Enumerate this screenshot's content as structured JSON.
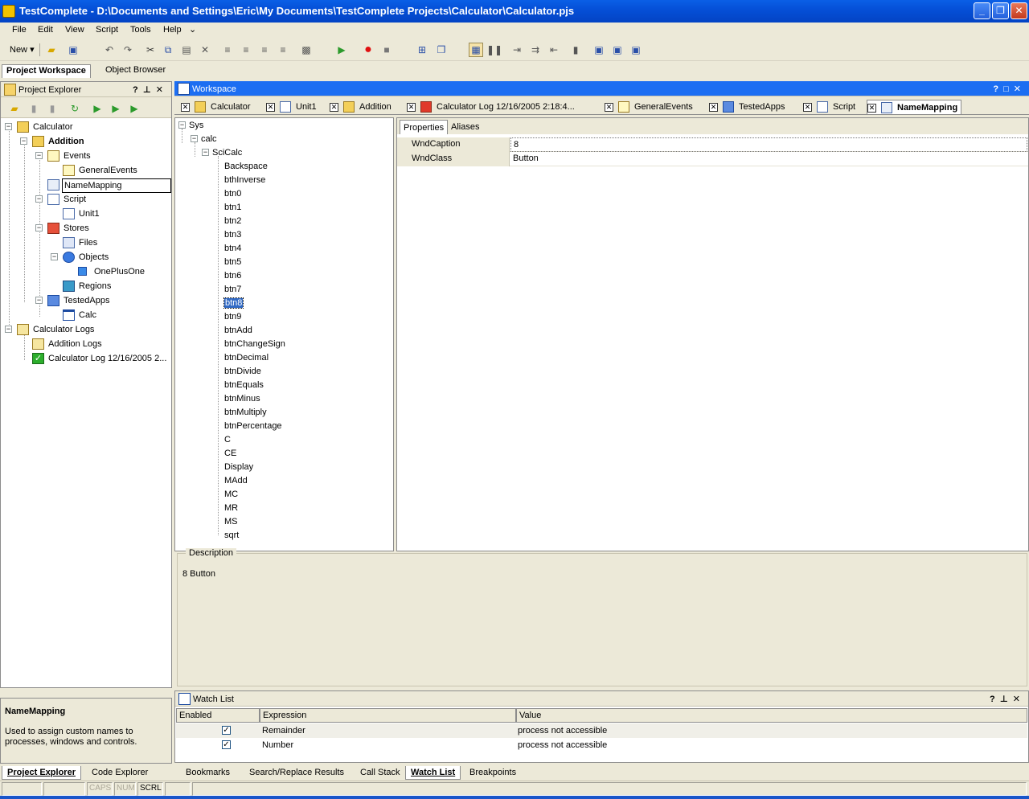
{
  "window": {
    "title": "TestComplete - D:\\Documents and Settings\\Eric\\My Documents\\TestComplete Projects\\Calculator\\Calculator.pjs"
  },
  "menu": [
    "File",
    "Edit",
    "View",
    "Script",
    "Tools",
    "Help"
  ],
  "toolbar": {
    "new_label": "New"
  },
  "workspace_tabs": {
    "project_workspace": "Project Workspace",
    "object_browser": "Object Browser"
  },
  "project_explorer": {
    "title": "Project Explorer",
    "tree": [
      {
        "label": "Calculator",
        "icon": "folder-project-icon"
      },
      {
        "label": "Addition",
        "icon": "folder-icon",
        "bold": true
      },
      {
        "label": "Events",
        "icon": "events-icon"
      },
      {
        "label": "GeneralEvents",
        "icon": "event-icon"
      },
      {
        "label": "NameMapping",
        "icon": "namemapping-icon"
      },
      {
        "label": "Script",
        "icon": "script-icon"
      },
      {
        "label": "Unit1",
        "icon": "unit-icon"
      },
      {
        "label": "Stores",
        "icon": "stores-icon"
      },
      {
        "label": "Files",
        "icon": "files-icon"
      },
      {
        "label": "Objects",
        "icon": "objects-icon"
      },
      {
        "label": "OnePlusOne",
        "icon": "cube-icon"
      },
      {
        "label": "Regions",
        "icon": "regions-icon"
      },
      {
        "label": "TestedApps",
        "icon": "testedapps-icon"
      },
      {
        "label": "Calc",
        "icon": "app-icon"
      },
      {
        "label": "Calculator Logs",
        "icon": "logs-icon"
      },
      {
        "label": "Addition Logs",
        "icon": "log-icon"
      },
      {
        "label": "Calculator Log 12/16/2005 2...",
        "icon": "check-icon"
      }
    ]
  },
  "hint": {
    "title": "NameMapping",
    "text": "Used to assign custom names to processes, windows and controls."
  },
  "left_bottom_tabs": [
    "Project Explorer",
    "Code Explorer"
  ],
  "workspace": {
    "title": "Workspace",
    "tabs": [
      "Calculator",
      "Unit1",
      "Addition",
      "Calculator Log 12/16/2005 2:18:4...",
      "GeneralEvents",
      "TestedApps",
      "Script",
      "NameMapping"
    ],
    "object_tree": {
      "root": "Sys",
      "level1": "calc",
      "level2": "SciCalc",
      "items": [
        "Backspace",
        "bthInverse",
        "btn0",
        "btn1",
        "btn2",
        "btn3",
        "btn4",
        "btn5",
        "btn6",
        "btn7",
        "btn8",
        "btn9",
        "btnAdd",
        "btnChangeSign",
        "btnDecimal",
        "btnDivide",
        "btnEquals",
        "btnMinus",
        "btnMultiply",
        "btnPercentage",
        "C",
        "CE",
        "Display",
        "MAdd",
        "MC",
        "MR",
        "MS",
        "sqrt"
      ],
      "selected": "btn8"
    },
    "property_tabs": [
      "Properties",
      "Aliases"
    ],
    "properties": [
      {
        "name": "WndCaption",
        "value": "8"
      },
      {
        "name": "WndClass",
        "value": "Button"
      }
    ],
    "description": {
      "label": "Description",
      "text": "8 Button"
    }
  },
  "watch_list": {
    "title": "Watch List",
    "columns": [
      "Enabled",
      "Expression",
      "Value"
    ],
    "rows": [
      {
        "enabled": "✓",
        "expression": "Remainder",
        "value": "process not accessible"
      },
      {
        "enabled": "✓",
        "expression": "Number",
        "value": "process not accessible"
      }
    ]
  },
  "bottom_tabs": [
    "Bookmarks",
    "Search/Replace Results",
    "Call Stack",
    "Watch List",
    "Breakpoints"
  ],
  "status": {
    "caps": "CAPS",
    "num": "NUM",
    "scrl": "SCRL"
  },
  "colors": {
    "title_blue": "#0550d8",
    "pane_header_blue": "#1c6ef2",
    "selection": "#316ac5"
  }
}
